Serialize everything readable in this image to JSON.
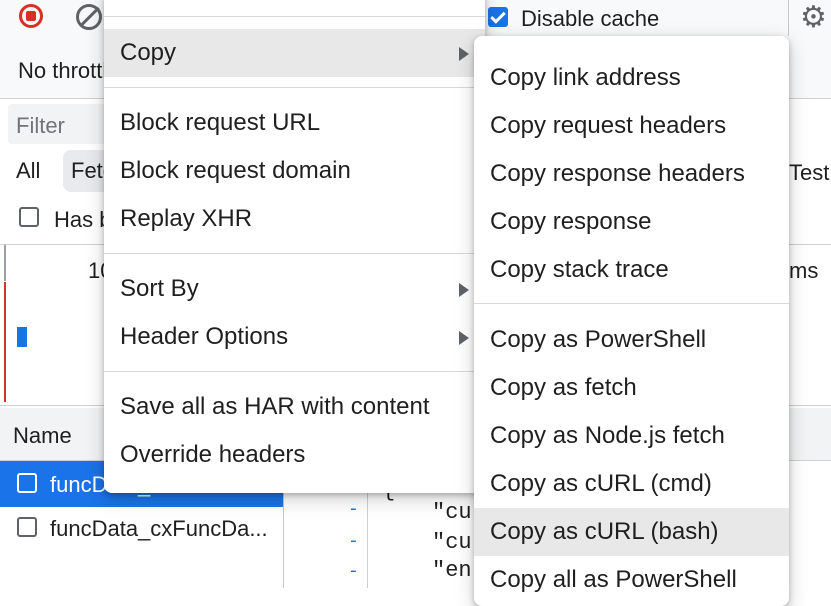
{
  "toolbar": {
    "throttle_label": "No throttling",
    "disable_cache_label": "Disable cache"
  },
  "filter": {
    "placeholder": "Filter",
    "type_all": "All",
    "type_fetch": "Fetch/XHR",
    "type_rest": "Test",
    "has_blocked_label": "Has blocked cookies"
  },
  "overview": {
    "tick_label": "10",
    "ms_label": "ms"
  },
  "requests": {
    "name_header": "Name",
    "rows": [
      "funcData_",
      "funcData_cxFuncDa..."
    ]
  },
  "response": {
    "lines": [
      "\"cu",
      "\"cu",
      "\"en"
    ],
    "brace": "{"
  },
  "context_menu": {
    "items": [
      {
        "label": "Copy",
        "submenu": true
      },
      {
        "label": "Block request URL"
      },
      {
        "label": "Block request domain"
      },
      {
        "label": "Replay XHR"
      },
      {
        "label": "Sort By",
        "submenu": true
      },
      {
        "label": "Header Options",
        "submenu": true
      },
      {
        "label": "Save all as HAR with content"
      },
      {
        "label": "Override headers"
      }
    ]
  },
  "copy_submenu": {
    "items": [
      "Copy link address",
      "Copy request headers",
      "Copy response headers",
      "Copy response",
      "Copy stack trace",
      "Copy as PowerShell",
      "Copy as fetch",
      "Copy as Node.js fetch",
      "Copy as cURL (cmd)",
      "Copy as cURL (bash)",
      "Copy all as PowerShell"
    ]
  },
  "colors": {
    "accent": "#1a73e8",
    "record": "#d93025",
    "highlight": "#e8e8e8"
  }
}
